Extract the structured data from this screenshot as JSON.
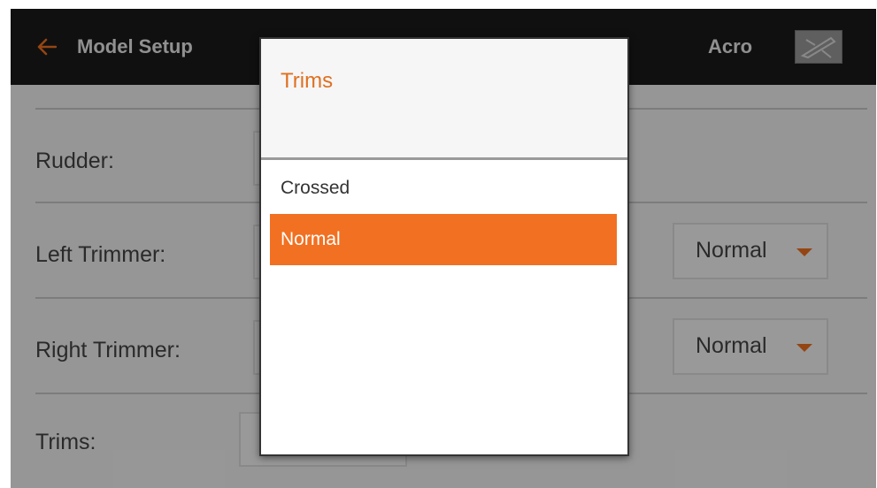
{
  "header": {
    "back_icon": "back-arrow-icon",
    "title": "Model Setup",
    "mode": "Acro",
    "model_icon": "airplane-icon",
    "accent": "#f27021"
  },
  "rows": [
    {
      "label": "Rudder:",
      "value": ""
    },
    {
      "label": "Left Trimmer:",
      "value": "Normal"
    },
    {
      "label": "Right Trimmer:",
      "value": "Normal"
    },
    {
      "label": "Trims:",
      "value": ""
    }
  ],
  "dialog": {
    "title": "Trims",
    "options": [
      "Crossed",
      "Normal"
    ],
    "selected": "Normal"
  }
}
